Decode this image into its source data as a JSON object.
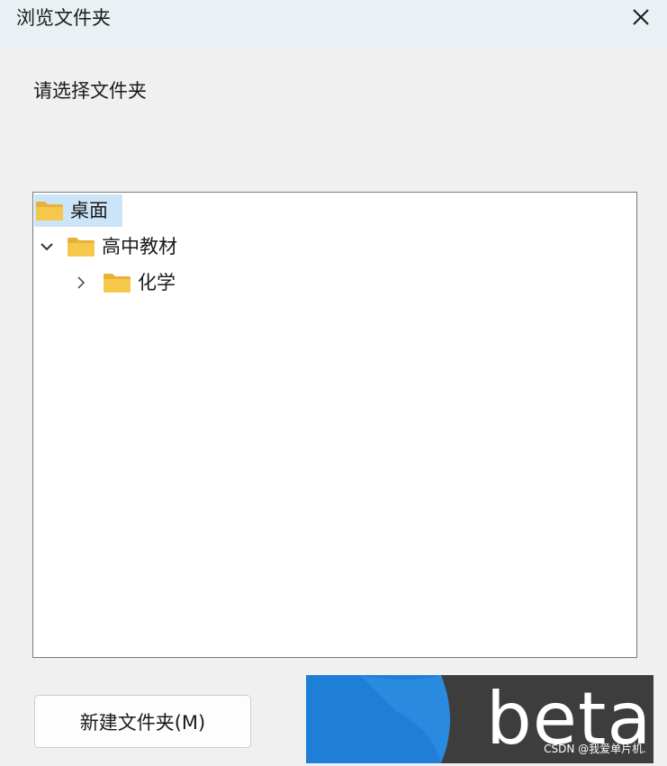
{
  "dialog": {
    "title": "浏览文件夹",
    "prompt": "请选择文件夹"
  },
  "tree": {
    "items": [
      {
        "label": "桌面",
        "selected": true,
        "expanded": null
      },
      {
        "label": "高中教材",
        "selected": false,
        "expanded": true
      },
      {
        "label": "化学",
        "selected": false,
        "expanded": false
      }
    ]
  },
  "buttons": {
    "new_folder": "新建文件夹(M)"
  },
  "overlay": {
    "logo_text": "beta",
    "watermark": "CSDN @我爱单片机."
  },
  "colors": {
    "selection": "#cce4f7",
    "folder": "#f5c84c",
    "logo_blue": "#1f7fd6"
  }
}
